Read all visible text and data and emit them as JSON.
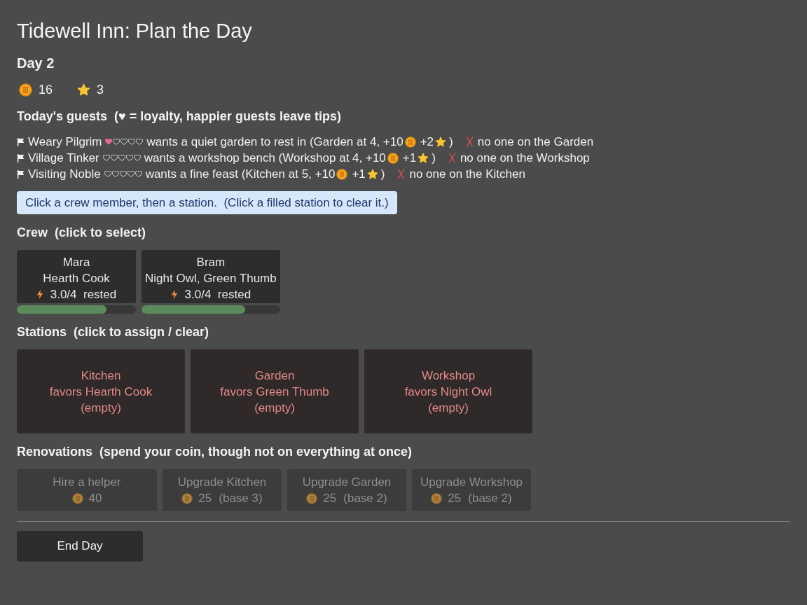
{
  "title": "Tidewell Inn: Plan the Day",
  "day": "Day 2",
  "stats": [
    {
      "kind": "coin",
      "value": "16"
    },
    {
      "kind": "star",
      "value": "3"
    }
  ],
  "guests_heading": "Today's guests  (♥ = loyalty, happier guests leave tips)",
  "guests": [
    {
      "name": "Weary Pilgrim",
      "stars": 1,
      "request": "wants a quiet garden to rest in (Garden at 4, +10",
      "star_reward": "+2",
      "closing": ")",
      "met": false,
      "status": "no one on the Garden"
    },
    {
      "name": "Village Tinker",
      "stars": 0,
      "request": "wants a workshop bench (Workshop at 4, +10",
      "star_reward": "+1",
      "closing": ")",
      "met": false,
      "status": "no one on the Workshop"
    },
    {
      "name": "Visiting Noble",
      "stars": 0,
      "request": "wants a fine feast (Kitchen at 5, +10",
      "star_reward": "+1",
      "closing": ")",
      "met": false,
      "status": "no one on the Kitchen"
    }
  ],
  "hint": "Click a crew member, then a station.  (Click a filled station to clear it.)",
  "crew_heading": "Crew  (click to select)",
  "crew": [
    {
      "name": "Mara",
      "traits": "Hearth Cook",
      "energy": "3.0/4  rested",
      "level": 0.75,
      "selected": false
    },
    {
      "name": "Bram",
      "traits": "Night Owl, Green Thumb",
      "energy": "3.0/4  rested",
      "level": 0.75,
      "selected": false
    }
  ],
  "stations_heading": "Stations  (click to assign / clear)",
  "stations": [
    {
      "name": "Kitchen",
      "favors": "favors Hearth Cook",
      "assignee": "(empty)",
      "filled": false
    },
    {
      "name": "Garden",
      "favors": "favors Green Thumb",
      "assignee": "(empty)",
      "filled": false
    },
    {
      "name": "Workshop",
      "favors": "favors Night Owl",
      "assignee": "(empty)",
      "filled": false
    }
  ],
  "renovations_heading": "Renovations  (spend your coin, though not on everything at once)",
  "renovations": [
    {
      "kind": "hire",
      "label": "Hire a helper",
      "cost": "40",
      "disabled": true
    },
    {
      "kind": "upgrade",
      "label": "Upgrade Kitchen",
      "cost": "25",
      "note": "(base 3)",
      "disabled": true
    },
    {
      "kind": "upgrade",
      "label": "Upgrade Garden",
      "cost": "25",
      "note": "(base 2)",
      "disabled": true
    },
    {
      "kind": "upgrade",
      "label": "Upgrade Workshop",
      "cost": "25",
      "note": "(base 2)",
      "disabled": true
    }
  ],
  "end_button": "End Day"
}
